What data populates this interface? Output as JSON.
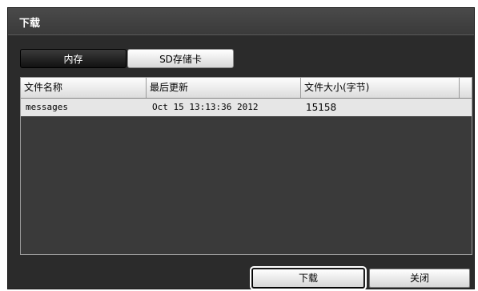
{
  "dialog": {
    "title": "下载"
  },
  "tabs": [
    {
      "label": "内存",
      "active": true
    },
    {
      "label": "SD存储卡",
      "active": false
    }
  ],
  "table": {
    "columns": [
      "文件名称",
      "最后更新",
      "文件大小(字节)"
    ],
    "rows": [
      {
        "name": "messages",
        "modified": "Oct 15 13:13:36 2012",
        "size": "15158"
      }
    ]
  },
  "buttons": {
    "download": "下载",
    "close": "关闭"
  },
  "colors": {
    "dialog_bg": "#2b2b2b",
    "row_bg": "#e6e6e6",
    "header_bg": "#dcdcdc"
  }
}
